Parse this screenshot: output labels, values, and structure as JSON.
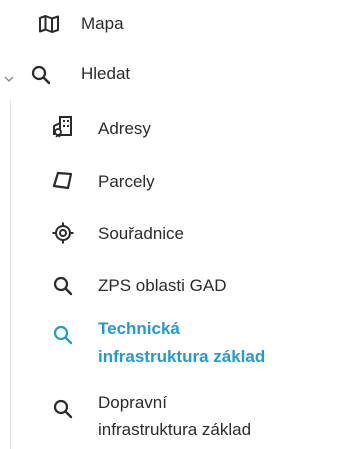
{
  "nav": {
    "items": [
      {
        "label": "Mapa",
        "icon": "map-icon"
      },
      {
        "label": "Hledat",
        "icon": "search-icon",
        "expanded": true
      },
      {
        "label": "Adresy",
        "icon": "address-building-icon"
      },
      {
        "label": "Parcely",
        "icon": "parcel-polygon-icon"
      },
      {
        "label": "Souřadnice",
        "icon": "coordinates-target-icon"
      },
      {
        "label": "ZPS oblasti GAD",
        "icon": "search-icon"
      },
      {
        "label_line1": "Technická",
        "label_line2": "infrastruktura základ",
        "icon": "search-icon",
        "active": true
      },
      {
        "label_line1": "Dopravní",
        "label_line2": "infrastruktura základ",
        "icon": "search-icon"
      }
    ]
  },
  "colors": {
    "text": "#2b2b2b",
    "active": "#1f9bd7",
    "chevron": "#8a8a8a",
    "rail": "#e3e3e3"
  }
}
